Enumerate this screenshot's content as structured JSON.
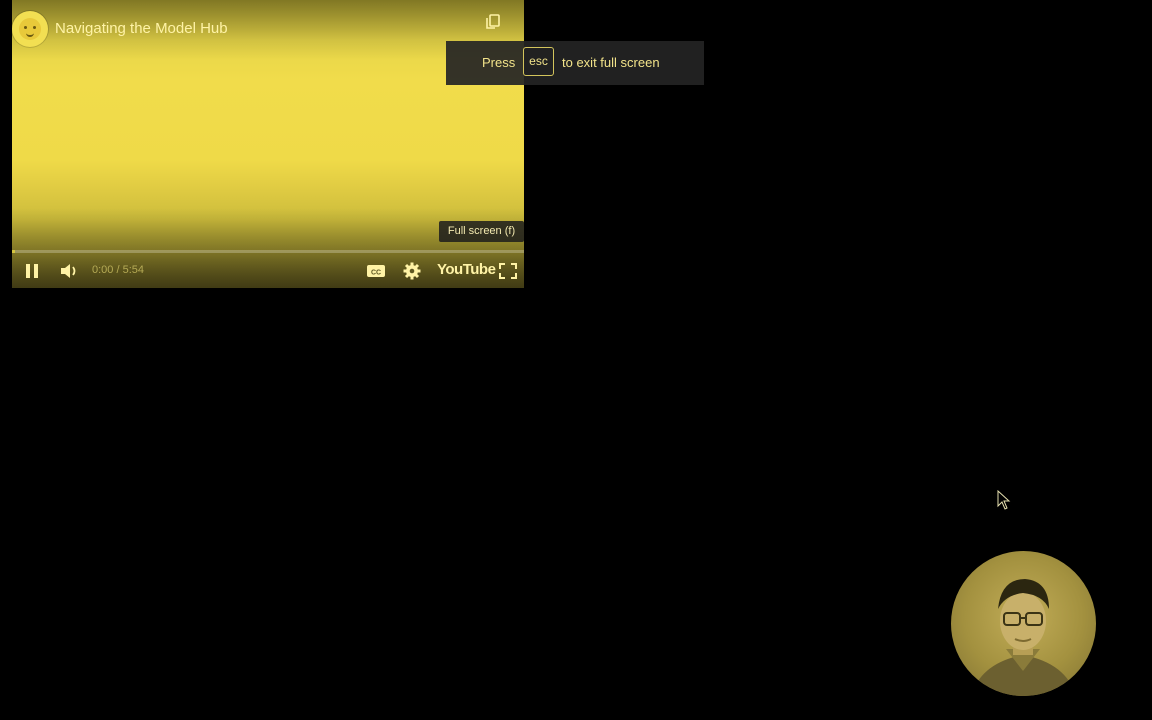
{
  "player": {
    "title": "Navigating the Model Hub",
    "time_display": "0:00 / 5:54",
    "progress_fraction": 0.0,
    "fullscreen_tooltip": "Full screen (f)",
    "youtube_label": "YouTube",
    "icons": {
      "channel": "hugging-face-avatar",
      "copy": "copy-link-icon",
      "pause": "pause-icon",
      "volume": "volume-icon",
      "captions": "closed-captions-icon",
      "settings": "gear-icon",
      "fullscreen": "fullscreen-icon"
    }
  },
  "fullscreen_hint": {
    "press": "Press",
    "key": "esc",
    "suffix": "to exit full screen"
  },
  "colors": {
    "background": "#000000",
    "video_tint": "#f1dc4b",
    "control_text": "#fff3a6"
  }
}
